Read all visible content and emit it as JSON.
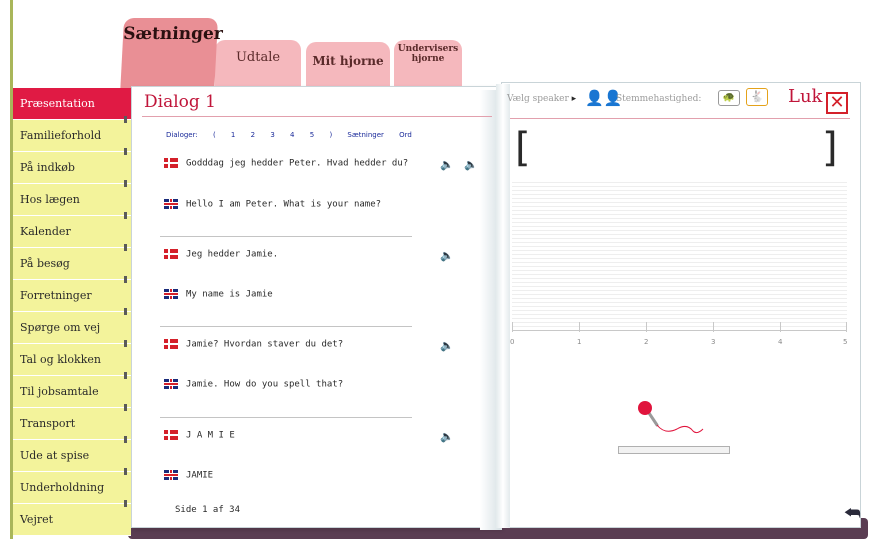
{
  "tabs": {
    "saetninger": "Sætninger",
    "udtale": "Udtale",
    "mit_hjorne": "Mit hjorne",
    "undervisers_line1": "Undervisers",
    "undervisers_line2": "hjorne"
  },
  "sidebar": {
    "items": [
      {
        "label": "Præsentation",
        "active": true
      },
      {
        "label": "Familieforhold",
        "active": false
      },
      {
        "label": "På indkøb",
        "active": false
      },
      {
        "label": "Hos lægen",
        "active": false
      },
      {
        "label": "Kalender",
        "active": false
      },
      {
        "label": "På besøg",
        "active": false
      },
      {
        "label": "Forretninger",
        "active": false
      },
      {
        "label": "Spørge om vej",
        "active": false
      },
      {
        "label": "Tal og klokken",
        "active": false
      },
      {
        "label": "Til jobsamtale",
        "active": false
      },
      {
        "label": "Transport",
        "active": false
      },
      {
        "label": "Ude at spise",
        "active": false
      },
      {
        "label": "Underholdning",
        "active": false
      },
      {
        "label": "Vejret",
        "active": false
      }
    ]
  },
  "dialog": {
    "title": "Dialog 1",
    "nav": {
      "label": "Dialoger:",
      "open_paren": "(",
      "numbers": [
        "1",
        "2",
        "3",
        "4",
        "5"
      ],
      "close_paren": ")",
      "saetninger": "Sætninger",
      "ord": "Ord"
    },
    "lines": [
      {
        "danish": "Godddag jeg  hedder Peter. Hvad hedder du?",
        "english": "Hello I am Peter. What is your name?"
      },
      {
        "danish": "Jeg hedder Jamie.",
        "english": "My name is Jamie"
      },
      {
        "danish": "Jamie? Hvordan staver du det?",
        "english": "Jamie. How do you spell that?"
      },
      {
        "danish": "J A M I E",
        "english": "JAMIE"
      }
    ],
    "page_indicator": "Side 1 af 34"
  },
  "right_panel": {
    "speaker_label": "Vælg speaker",
    "speed_label": "Stemmehastighed:",
    "close_label": "Luk",
    "open_bracket": "[",
    "close_bracket": "]",
    "axis_labels": [
      "0",
      "1",
      "2",
      "3",
      "4",
      "5"
    ],
    "progress": 0.0
  },
  "colors": {
    "accent_red": "#e01a44",
    "sidebar_yellow": "#f3f39b",
    "tab_pink": "#f5b8bd"
  }
}
